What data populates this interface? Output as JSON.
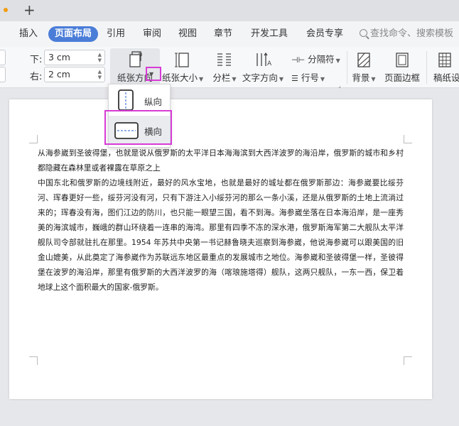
{
  "tabs": {
    "new_tab_label": "+"
  },
  "menu": {
    "items": [
      "插入",
      "页面布局",
      "引用",
      "审阅",
      "视图",
      "章节",
      "开发工具",
      "会员专享"
    ],
    "active": "页面布局",
    "search_placeholder": "查找命令、搜索模板"
  },
  "ribbon": {
    "bottom_label": "下:",
    "bottom_value": "3 cm",
    "right_label": "右:",
    "right_value": "2 cm",
    "orientation_label": "纸张方向",
    "size_label": "纸张大小",
    "columns_label": "分栏",
    "text_direction_label": "文字方向",
    "separator_label": "分隔符",
    "line_number_label": "行号",
    "background_label": "背景",
    "page_border_label": "页面边框",
    "paper_setting_label": "稿纸设"
  },
  "dropdown": {
    "portrait_label": "纵向",
    "landscape_label": "横向"
  },
  "document": {
    "paragraphs": [
      "从海参崴到圣彼得堡，也就是说从俄罗斯的太平洋日本海海滨到大西洋波罗的海沿岸，俄罗斯的城市和乡村都隐藏在森林里或者裸露在草原之上",
      "中国东北和俄罗斯的边境线附近，最好的风水宝地，也就是最好的城址都在俄罗斯那边：海参崴要比绥芬河、珲春更好一些，绥芬河没有河，只有下游注入小绥芬河的那么一条小溪，还是从俄罗斯的土地上流淌过来的；珲春没有海，图们江边的防川，也只能一眼望三国，看不到海。海参崴坐落在日本海沿岸，是一座秀美的海滨城市，巍峨的群山环绕着一连串的海湾。那里有四季不冻的深水港，俄罗斯海军第二大舰队太平洋舰队司令部就驻扎在那里。1954 年苏共中央第一书记赫鲁晓夫巡察到海参崴，他说海参崴可以跟美国的旧金山媲美，从此奠定了海参崴作为苏联远东地区最重点的发展城市之地位。海参崴和圣彼得堡一样，圣彼得堡在波罗的海沿岸，那里有俄罗斯的大西洋波罗的海（喀琅施塔得）舰队，这两只舰队，一东一西，保卫着地球上这个面积最大的国家-俄罗斯。"
    ]
  },
  "colors": {
    "accent": "#4a7dd8",
    "highlight": "#d83bd6"
  }
}
